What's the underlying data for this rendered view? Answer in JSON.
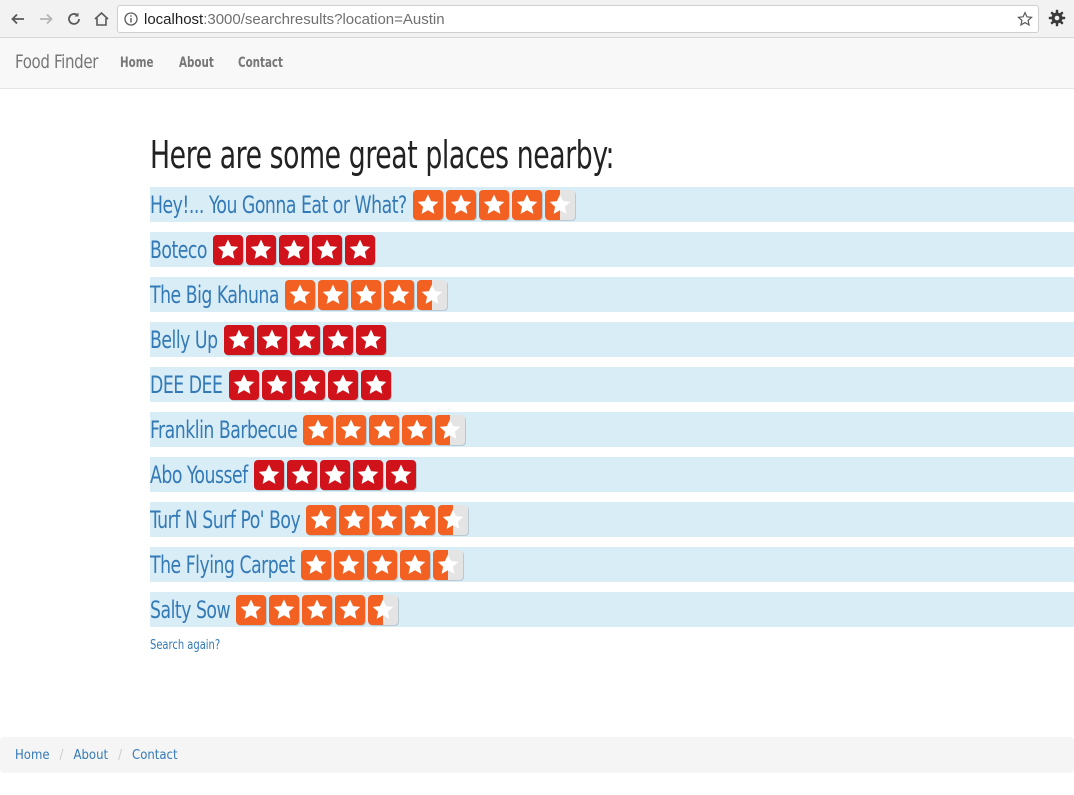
{
  "browser": {
    "url_host": "localhost",
    "url_path": ":3000/searchresults?location=Austin"
  },
  "navbar": {
    "brand": "Food Finder",
    "links": [
      {
        "label": "Home"
      },
      {
        "label": "About"
      },
      {
        "label": "Contact"
      }
    ]
  },
  "main": {
    "heading": "Here are some great places nearby:",
    "results": [
      {
        "name": "Hey!... You Gonna Eat or What?",
        "rating": 4.5
      },
      {
        "name": "Boteco",
        "rating": 5
      },
      {
        "name": "The Big Kahuna",
        "rating": 4.5
      },
      {
        "name": "Belly Up",
        "rating": 5
      },
      {
        "name": "DEE DEE",
        "rating": 5
      },
      {
        "name": "Franklin Barbecue",
        "rating": 4.5
      },
      {
        "name": "Abo Youssef",
        "rating": 5
      },
      {
        "name": "Turf N Surf Po' Boy",
        "rating": 4.5
      },
      {
        "name": "The Flying Carpet",
        "rating": 4.5
      },
      {
        "name": "Salty Sow",
        "rating": 4.5
      }
    ],
    "search_again": "Search again?"
  },
  "footer": {
    "breadcrumb": [
      {
        "label": "Home"
      },
      {
        "label": "About"
      },
      {
        "label": "Contact"
      }
    ]
  },
  "colors": {
    "star_full_5": "#d0121b",
    "star_full_45": "#f26122",
    "star_empty": "#e4e4e4",
    "row_bg": "#d9edf7",
    "link": "#337ab7"
  }
}
